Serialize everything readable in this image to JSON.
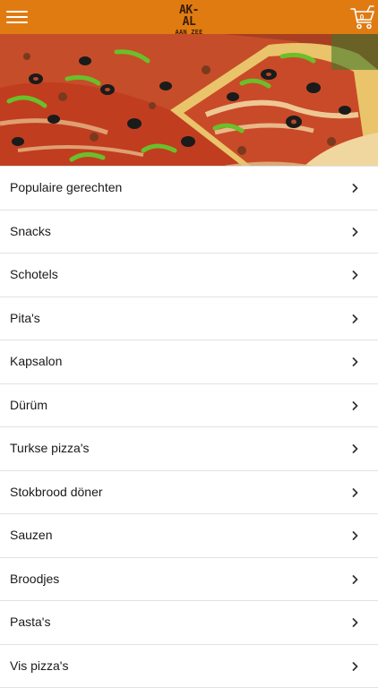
{
  "header": {
    "logo_line1": "AK-AL",
    "logo_line2": "AAN ZEE",
    "cart_count": "0",
    "menu_icon": "hamburger-menu-icon",
    "cart_icon": "shopping-cart-icon"
  },
  "hero": {
    "image": "pizza-photo",
    "colors": {
      "accent": "#e07b12",
      "sauce": "#c9452a"
    }
  },
  "categories": [
    {
      "label": "Populaire gerechten"
    },
    {
      "label": "Snacks"
    },
    {
      "label": "Schotels"
    },
    {
      "label": "Pita's"
    },
    {
      "label": "Kapsalon"
    },
    {
      "label": "Dürüm"
    },
    {
      "label": "Turkse pizza's"
    },
    {
      "label": "Stokbrood döner"
    },
    {
      "label": "Sauzen"
    },
    {
      "label": "Broodjes"
    },
    {
      "label": "Pasta's"
    },
    {
      "label": "Vis pizza's"
    }
  ]
}
